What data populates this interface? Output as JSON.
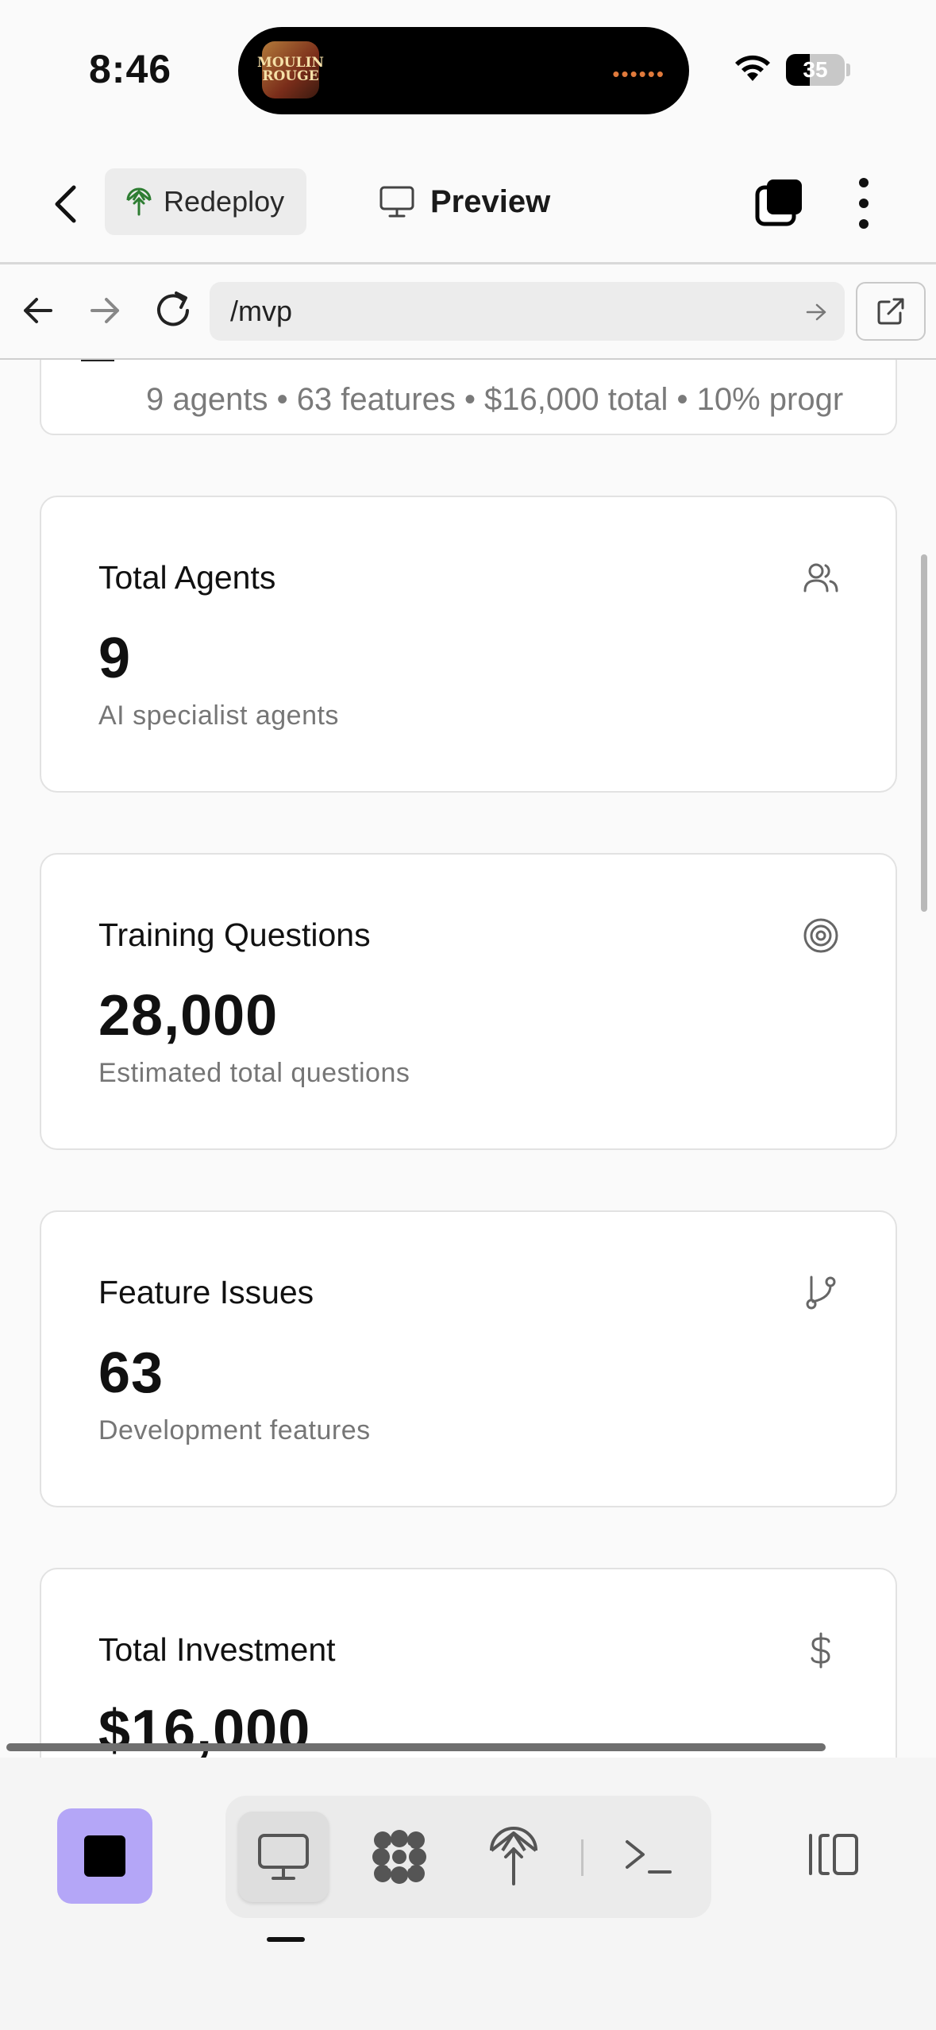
{
  "status_bar": {
    "time": "8:46",
    "now_playing_art_text": "MOULIN ROUGE",
    "activity_dots": "••••••",
    "battery_level": "35"
  },
  "header": {
    "redeploy_label": "Redeploy",
    "preview_label": "Preview",
    "accent_green": "#2e7d32"
  },
  "browser": {
    "url": "/mvp"
  },
  "summary": {
    "text": "9 agents • 63 features • $16,000 total • 10% progr"
  },
  "stats": [
    {
      "title": "Total Agents",
      "value": "9",
      "subtitle": "AI specialist agents",
      "icon": "users-icon"
    },
    {
      "title": "Training Questions",
      "value": "28,000",
      "subtitle": "Estimated total questions",
      "icon": "target-icon"
    },
    {
      "title": "Feature Issues",
      "value": "63",
      "subtitle": "Development features",
      "icon": "git-branch-icon"
    },
    {
      "title": "Total Investment",
      "value": "$16,000",
      "subtitle": "",
      "icon": "dollar-icon"
    }
  ],
  "dock": {
    "stop_color": "#b4a6f7",
    "tools": [
      "preview-tool",
      "agents-tool",
      "deploy-tool",
      "terminal-tool"
    ],
    "active_tool": "preview-tool"
  }
}
